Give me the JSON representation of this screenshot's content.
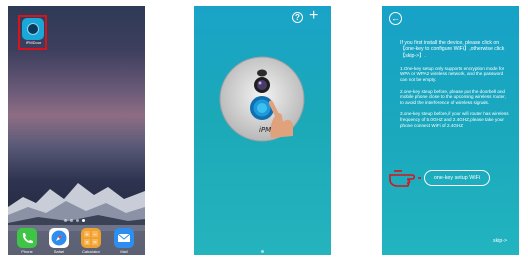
{
  "screen1": {
    "app_icon_label": "iPMDoor",
    "dock": [
      {
        "label": "Phone",
        "icon": "phone-icon"
      },
      {
        "label": "Safari",
        "icon": "safari-icon"
      },
      {
        "label": "Calculator",
        "icon": "calculator-icon"
      },
      {
        "label": "Mail",
        "icon": "mail-icon"
      }
    ]
  },
  "screen2": {
    "help_icon": "?",
    "add_icon": "+",
    "brand": "iPM"
  },
  "screen3": {
    "back_icon": "←",
    "intro": "If you first install the device, please click on【one-key to configure WiFi】,otherwise click 【skip->】.",
    "notes": [
      "1.One-key setup only supports encryption mode for WPA or WPA2 wireless network, and the password can not be empty.",
      "2.one-key steup before, please put the doorbell and mobile phone close to the upcoming wireless router, to avoid the interference of wireless signals.",
      "3.one-key steup before,if your wifi router has wireless frequency of 5.0GHZ and 2.4GHZ,please take your phone connect WiFi of 2.4GHZ"
    ],
    "setup_button": "one-key setup WiFi",
    "skip": "skip->"
  },
  "colors": {
    "teal_top": "#17a2c8",
    "teal_bottom": "#22b4bf",
    "highlight_red": "#d8141a"
  }
}
